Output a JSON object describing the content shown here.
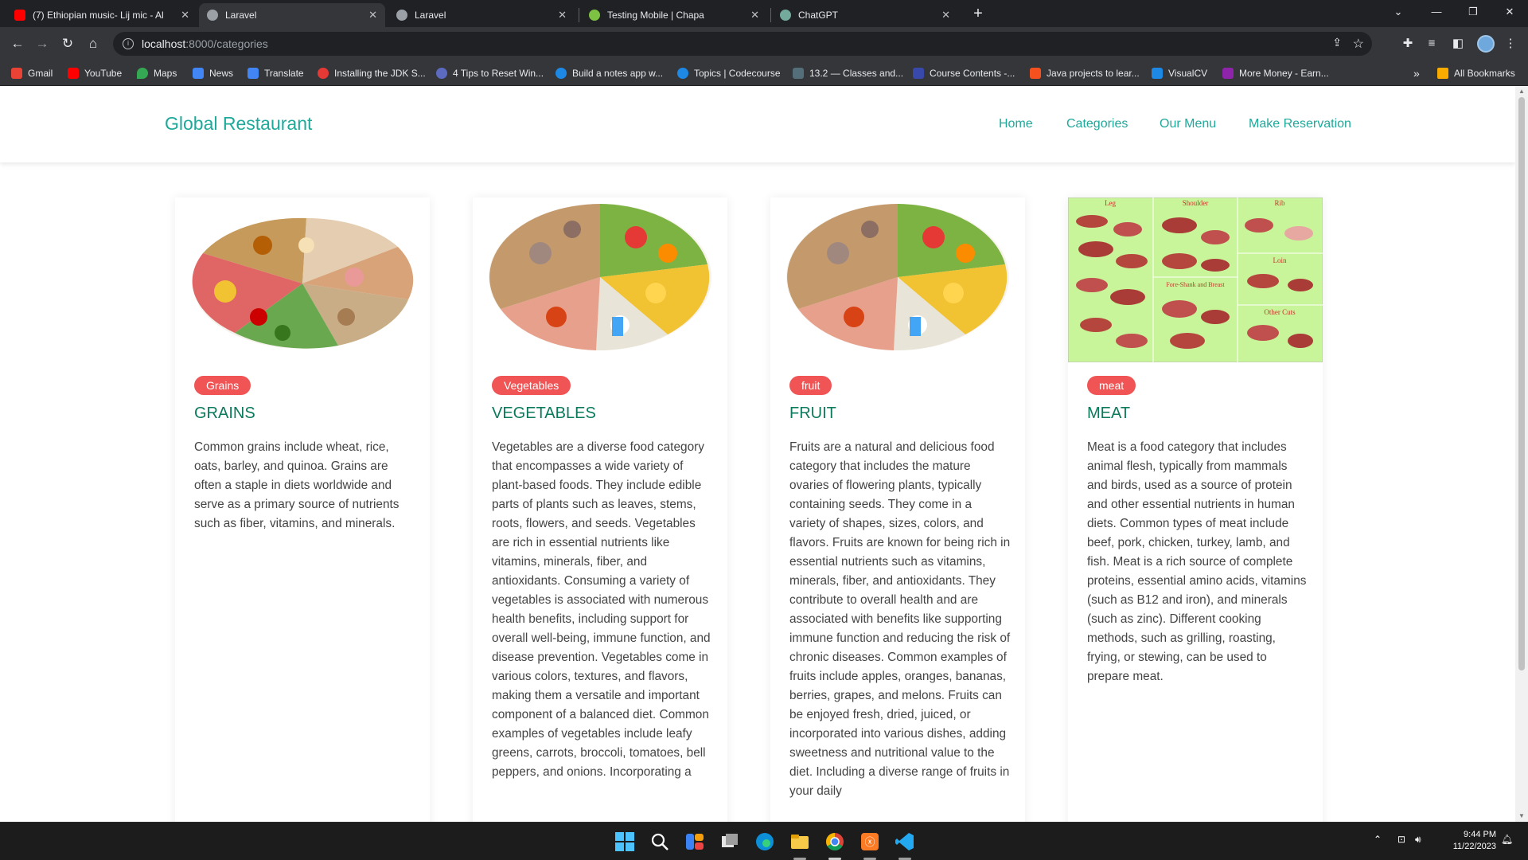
{
  "browser": {
    "tabs": [
      {
        "title": "(7) Ethiopian music- Lij mic - Al",
        "favicon_color": "#ff0000",
        "active": false
      },
      {
        "title": "Laravel",
        "favicon_color": "#9aa0a6",
        "active": true
      },
      {
        "title": "Laravel",
        "favicon_color": "#9aa0a6",
        "active": false
      },
      {
        "title": "Testing Mobile | Chapa",
        "favicon_color": "#7dc242",
        "active": false
      },
      {
        "title": "ChatGPT",
        "favicon_color": "#74aa9c",
        "active": false
      }
    ],
    "new_tab_icon": "+",
    "url_host": "localhost",
    "url_path": ":8000/categories",
    "bookmarks": [
      {
        "label": "Gmail",
        "icon_color": "#ea4335"
      },
      {
        "label": "YouTube",
        "icon_color": "#ff0000"
      },
      {
        "label": "Maps",
        "icon_color": "#34a853"
      },
      {
        "label": "News",
        "icon_color": "#4285f4"
      },
      {
        "label": "Translate",
        "icon_color": "#4285f4"
      },
      {
        "label": "Installing the JDK S...",
        "icon_color": "#e53935"
      },
      {
        "label": "4 Tips to Reset Win...",
        "icon_color": "#5c6bc0"
      },
      {
        "label": "Build a notes app w...",
        "icon_color": "#1e88e5"
      },
      {
        "label": "Topics | Codecourse",
        "icon_color": "#1e88e5"
      },
      {
        "label": "13.2 — Classes and...",
        "icon_color": "#546e7a"
      },
      {
        "label": "Course Contents -...",
        "icon_color": "#3949ab"
      },
      {
        "label": "Java projects to lear...",
        "icon_color": "#f4511e"
      },
      {
        "label": "VisualCV",
        "icon_color": "#1e88e5"
      },
      {
        "label": "More Money - Earn...",
        "icon_color": "#8e24aa"
      }
    ],
    "more_bookmarks": "»",
    "all_bookmarks": "All Bookmarks"
  },
  "site": {
    "brand": "Global Restaurant",
    "nav": [
      "Home",
      "Categories",
      "Our Menu",
      "Make Reservation"
    ],
    "brand_color": "#1fa99a"
  },
  "categories": [
    {
      "badge": "Grains",
      "title": "GRAINS",
      "description": "Common grains include wheat, rice, oats, barley, and quinoa. Grains are often a staple in diets worldwide and serve as a primary source of nutrients such as fiber, vitamins, and minerals."
    },
    {
      "badge": "Vegetables",
      "title": "VEGETABLES",
      "description": "Vegetables are a diverse food category that encompasses a wide variety of plant-based foods. They include edible parts of plants such as leaves, stems, roots, flowers, and seeds. Vegetables are rich in essential nutrients like vitamins, minerals, fiber, and antioxidants. Consuming a variety of vegetables is associated with numerous health benefits, including support for overall well-being, immune function, and disease prevention. Vegetables come in various colors, textures, and flavors, making them a versatile and important component of a balanced diet. Common examples of vegetables include leafy greens, carrots, broccoli, tomatoes, bell peppers, and onions. Incorporating a"
    },
    {
      "badge": "fruit",
      "title": "FRUIT",
      "description": "Fruits are a natural and delicious food category that includes the mature ovaries of flowering plants, typically containing seeds. They come in a variety of shapes, sizes, colors, and flavors. Fruits are known for being rich in essential nutrients such as vitamins, minerals, fiber, and antioxidants. They contribute to overall health and are associated with benefits like supporting immune function and reducing the risk of chronic diseases. Common examples of fruits include apples, oranges, bananas, berries, grapes, and melons. Fruits can be enjoyed fresh, dried, juiced, or incorporated into various dishes, adding sweetness and nutritional value to the diet. Including a diverse range of fruits in your daily"
    },
    {
      "badge": "meat",
      "title": "MEAT",
      "description": "Meat is a food category that includes animal flesh, typically from mammals and birds, used as a source of protein and other essential nutrients in human diets. Common types of meat include beef, pork, chicken, turkey, lamb, and fish. Meat is a rich source of complete proteins, essential amino acids, vitamins (such as B12 and iron), and minerals (such as zinc). Different cooking methods, such as grilling, roasting, frying, or stewing, can be used to prepare meat."
    }
  ],
  "meat_chart_labels": [
    "Leg",
    "Shoulder",
    "Rib",
    "Loin",
    "Fore-Shank and Breast",
    "Other Cuts"
  ],
  "taskbar": {
    "time": "9:44 PM",
    "date": "11/22/2023"
  }
}
